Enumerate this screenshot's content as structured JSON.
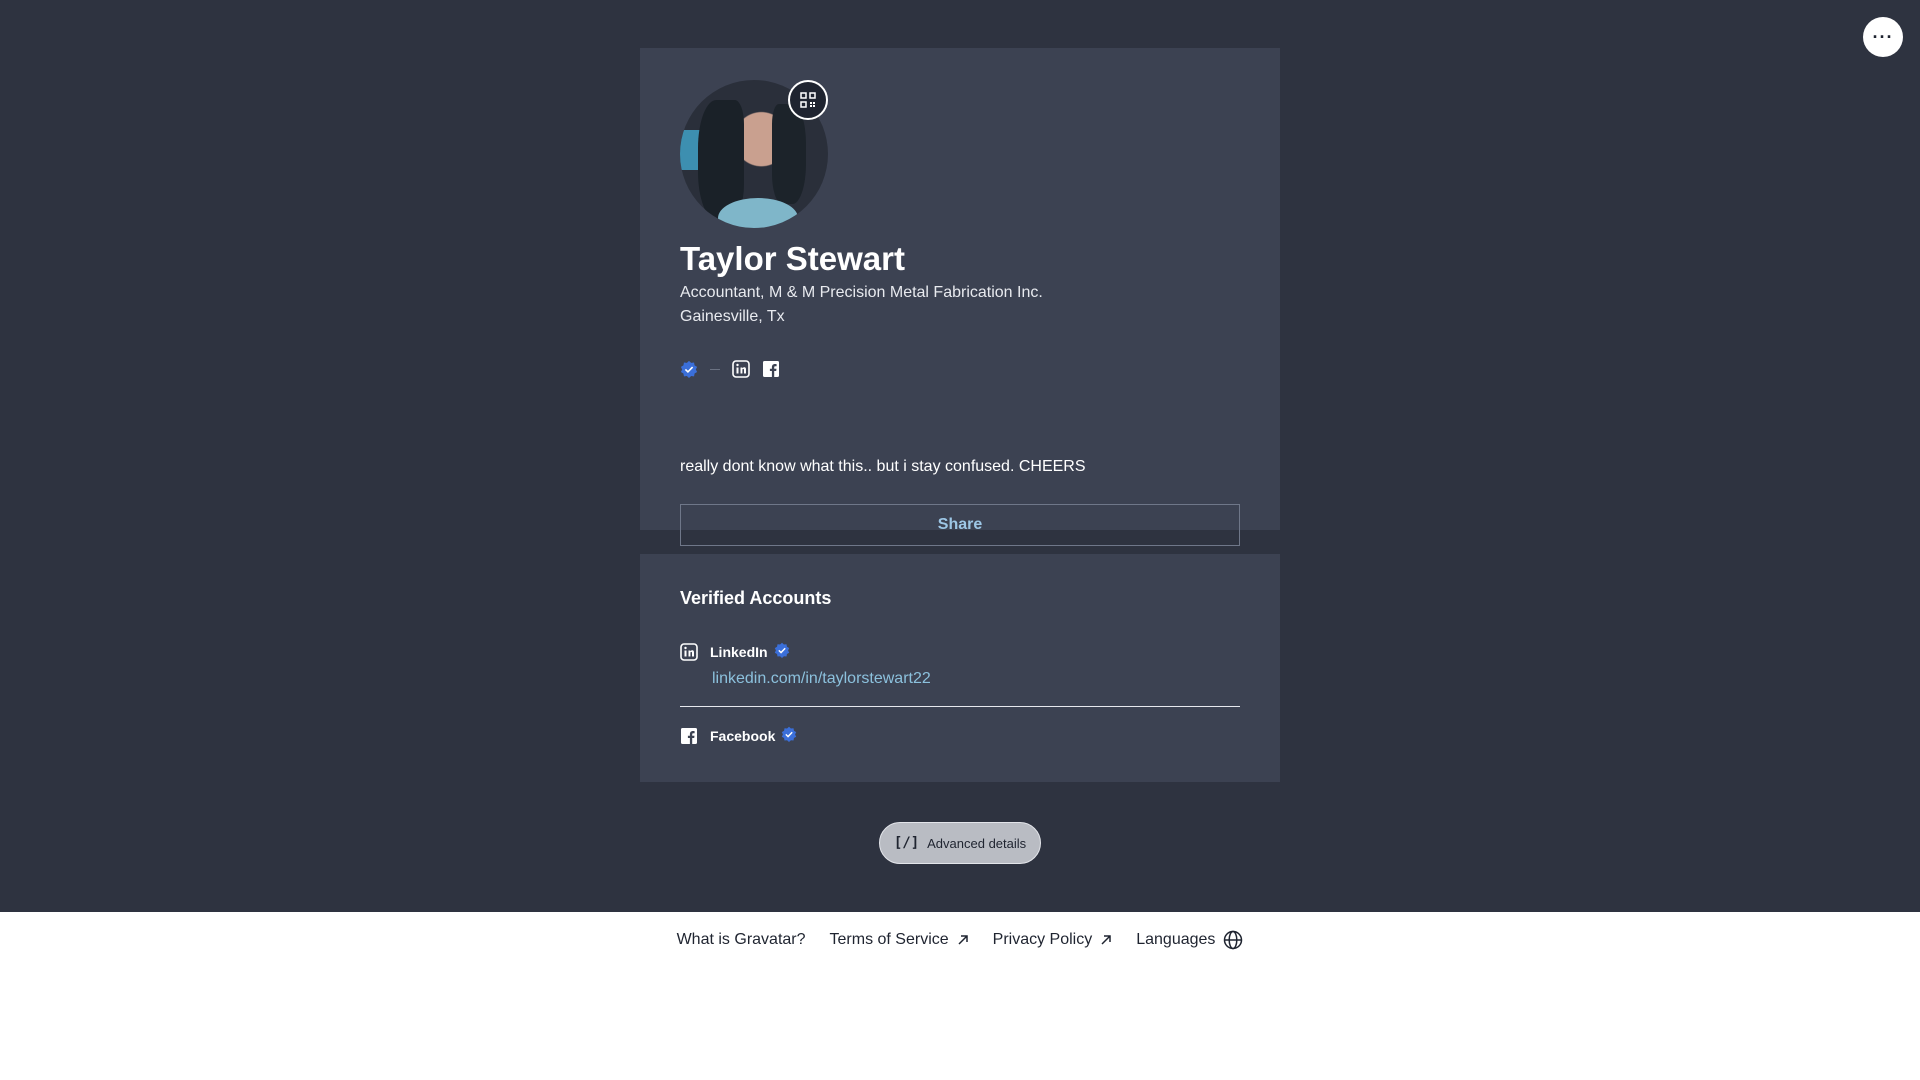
{
  "profile": {
    "name": "Taylor Stewart",
    "job": "Accountant, M & M Precision Metal Fabrication Inc.",
    "location": "Gainesville, Tx",
    "bio": "really dont know what this.. but i stay confused. CHEERS",
    "share_label": "Share",
    "icons": [
      "verified-badge-icon",
      "linkedin-icon",
      "facebook-icon"
    ]
  },
  "verified": {
    "title": "Verified Accounts",
    "accounts": [
      {
        "name": "LinkedIn",
        "url": "linkedin.com/in/taylorstewart22",
        "icon": "linkedin-icon"
      },
      {
        "name": "Facebook",
        "icon": "facebook-icon"
      }
    ]
  },
  "advanced": {
    "code": "[/]",
    "label": "Advanced details"
  },
  "footer": {
    "links": [
      {
        "label": "What is Gravatar?"
      },
      {
        "label": "Terms of Service",
        "icon": "external-link-icon"
      },
      {
        "label": "Privacy Policy",
        "icon": "external-link-icon"
      },
      {
        "label": "Languages",
        "icon": "globe-icon"
      }
    ]
  },
  "colors": {
    "page_bg": "#2e3340",
    "card_bg": "#3c4252",
    "link": "#8cc1dd",
    "verified_badge": "#3b6fd9"
  }
}
